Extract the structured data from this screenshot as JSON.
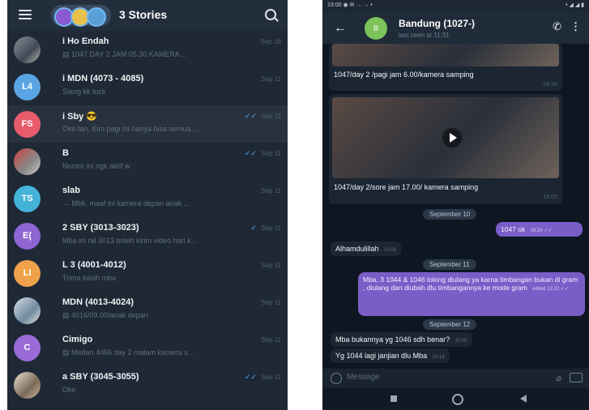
{
  "left_screen": {
    "stories_label": "3 Stories",
    "chats": [
      {
        "name": "i  Ho Endah",
        "preview": "▤ 1047 DAY 2 JAM 05.30 KAMERA...",
        "time": "Sep 16",
        "avatar": "",
        "avatar_color": "",
        "read": false
      },
      {
        "name": "i  MDN (4073 - 4085)",
        "preview": "Siang kk tuck",
        "time": "Sep 11",
        "avatar": "L4",
        "avatar_color": "#5aa4e4",
        "read": false
      },
      {
        "name": "i  Sby 😎",
        "preview": "Oke fan, Kim pagi ini hanya bisa semua ...",
        "time": "Sep 11",
        "avatar": "FS",
        "avatar_color": "#e85b6b",
        "read": true
      },
      {
        "name": "B",
        "preview": "Nomor ini ngk aktif w",
        "time": "Sep 11",
        "avatar": "",
        "avatar_color": "",
        "read": true
      },
      {
        "name": "slab",
        "preview": "→ Mbk, maaf ini kamera depan anak ...",
        "time": "Sep 11",
        "avatar": "TS",
        "avatar_color": "#43b3d7",
        "read": false
      },
      {
        "name": "2 SBY (3013-3023)",
        "preview": "Mba ini ral 3013 boleh kirim video hari k...",
        "time": "Sep 11",
        "avatar": "E(",
        "avatar_color": "#8e65d3",
        "read": true
      },
      {
        "name": "L   3 (4001-4012)",
        "preview": "Trima kasih mba",
        "time": "Sep 11",
        "avatar": "LI",
        "avatar_color": "#f0a24a",
        "read": false
      },
      {
        "name": "MDN (4013-4024)",
        "preview": "▤ 4016/09.00/anak depan",
        "time": "Sep 11",
        "avatar": "",
        "avatar_color": "",
        "read": false
      },
      {
        "name": "Cimigo",
        "preview": "▤ Medan 4066 day 2 malam kamera s...",
        "time": "Sep 11",
        "avatar": "C",
        "avatar_color": "#9a6ad6",
        "read": false
      },
      {
        "name": "a SBY (3045-3055)",
        "preview": "Oke",
        "time": "Sep 11",
        "avatar": "",
        "avatar_color": "",
        "read": true
      }
    ]
  },
  "right_screen": {
    "status_left": "23:00 ◉ ✉ → → •",
    "status_right": "• ◢ ◢ ▮",
    "chat_title": "Bandung (1027-)",
    "chat_subtitle": "last seen at 11:31",
    "avatar_text": "B",
    "messages": {
      "caption1": "1047/day 2 /pagi jam 6.00/kamera samping",
      "time1": "08:55",
      "caption2": "1047/day  2/sore jam 17.00/ kamera samping",
      "time2": "18:03",
      "date1": "September 10",
      "out1": "1047 ok",
      "out1_time": "09:24 ✓✓",
      "in1": "Alhamdulillah",
      "in1_time": "12:00",
      "date2": "September 11",
      "out2": "Mba,        3 1044 & 1046 tolong diulang ya karna timbangan bukan di gram , diulang dan diubah dlu timbangannya ke mode gram",
      "out2_time": "edited 13:22 ✓✓",
      "date3": "September 12",
      "in2": "Mba bukannya yg 1046 sdh benar?",
      "in2_time": "10:00",
      "in3": "Yg 1044 lagi janjian dlu Mba",
      "in3_time": "10:14"
    },
    "input_placeholder": "Message"
  },
  "colors": {
    "left_bg": "#1f2936",
    "right_bg": "#0e1621",
    "outgoing_bubble": "#7a5ec8",
    "incoming_bubble": "#1c2633",
    "check": "#5aa8e8"
  }
}
